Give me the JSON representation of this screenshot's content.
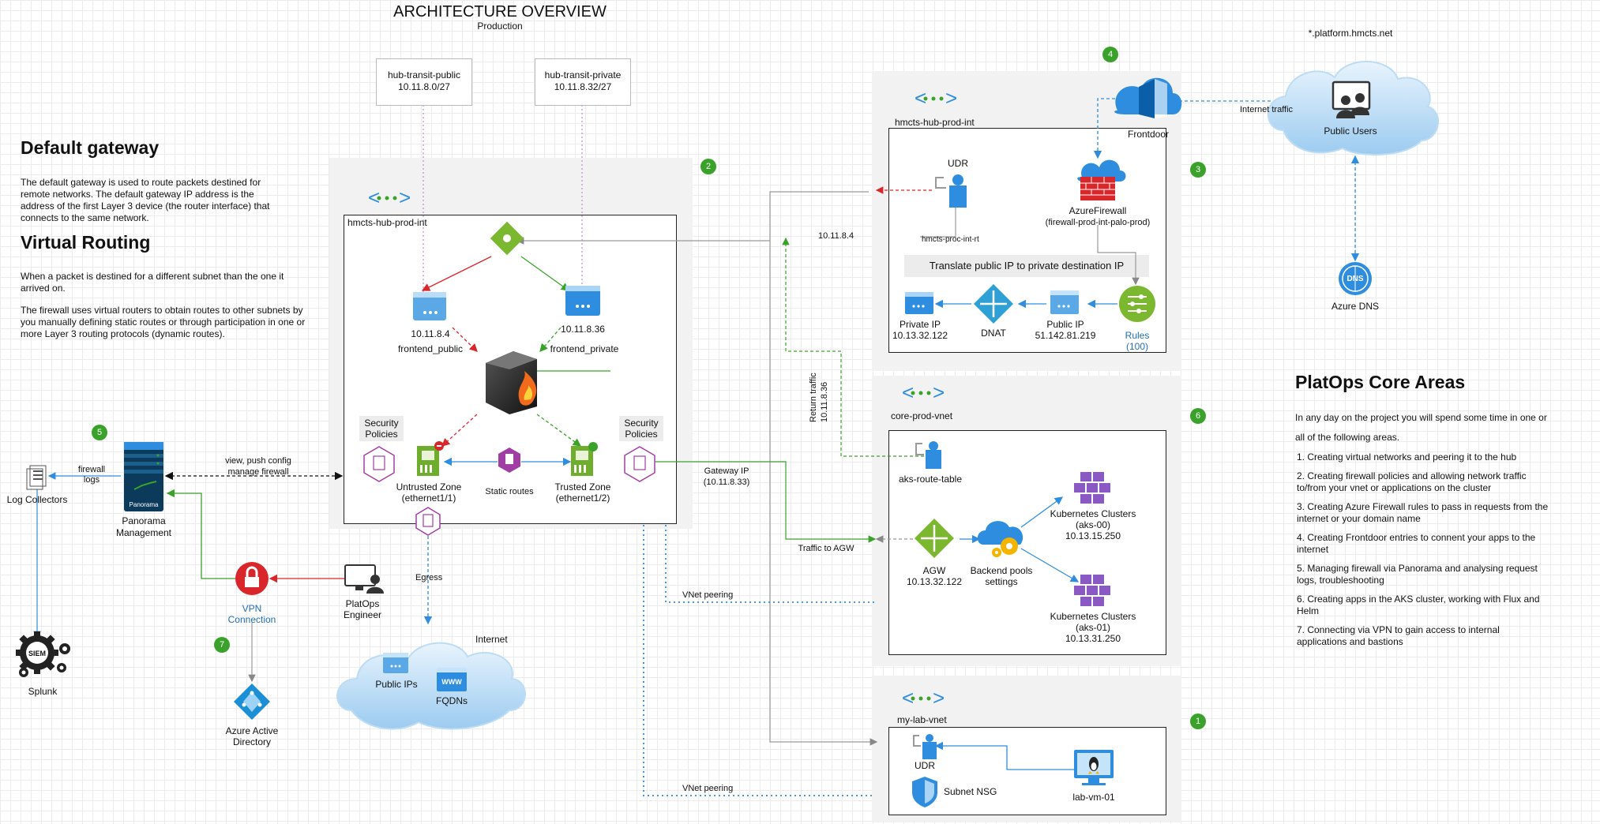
{
  "title": "ARCHITECTURE OVERVIEW",
  "subtitle": "Production",
  "default_gateway": {
    "heading": "Default gateway",
    "text": "The default gateway is used to route packets destined for remote networks. The default gateway IP address is the address of the first Layer 3 device (the router interface) that connects to the same network."
  },
  "virtual_routing": {
    "heading": "Virtual Routing",
    "p1": "When a packet is destined for a different subnet than the one it arrived on.",
    "p2": "The firewall uses virtual routers to obtain routes to other subnets by you manually defining static routes or through participation in one or more Layer 3 routing protocols (dynamic routes)."
  },
  "subnets": {
    "public": {
      "name": "hub-transit-public",
      "cidr": "10.11.8.0/27"
    },
    "private": {
      "name": "hub-transit-private",
      "cidr": "10.11.8.32/27"
    }
  },
  "hub": {
    "vnet": "hmcts-hub-prod-int",
    "frontend_public_ip": "10.11.8.4",
    "frontend_public": "frontend_public",
    "frontend_private_ip": "10.11.8.36",
    "frontend_private": "frontend_private",
    "security_policies": "Security Policies",
    "untrusted_zone": "Untrusted Zone",
    "untrusted_if": "(ethernet1/1)",
    "trusted_zone": "Trusted Zone",
    "trusted_if": "(ethernet1/2)",
    "static_routes": "Static routes"
  },
  "panorama": {
    "name": "Panorama Management",
    "badge_text": "Panorama",
    "link": "view, push config",
    "link2": "manage firewall",
    "firewall_logs": "firewall",
    "firewall_logs2": "logs"
  },
  "log_collectors": "Log Collectors",
  "splunk": "Splunk",
  "siem": "SIEM",
  "vpn": "VPN Connection",
  "engineer": "PlatOps Engineer",
  "aad": "Azure Active Directory",
  "egress": "Egress",
  "internet": {
    "label": "Internet",
    "public_ips": "Public IPs",
    "fqdns": "FQDNs",
    "www": "WWW"
  },
  "vnet_peering": "VNet peering",
  "gateway_ip": "Gateway IP",
  "gateway_ip2": "(10.11.8.33)",
  "traffic_to_agw": "Traffic to AGW",
  "return_traffic": "Return traffic",
  "return_ip": "10.11.8.36",
  "edge_ip": "10.11.8.4",
  "firewall_vnet": {
    "vnet": "hmcts-hub-prod-int",
    "udr": "UDR",
    "route_table": "hmcts-proc-int-rt",
    "azure_firewall": "AzureFirewall",
    "azure_firewall_name": "(firewall-prod-int-palo-prod)",
    "translate": "Translate public IP to private destination IP",
    "private_ip": "Private IP",
    "private_ip_val": "10.13.32.122",
    "dnat": "DNAT",
    "public_ip": "Public IP",
    "public_ip_val": "51.142.81.219",
    "rules": "Rules",
    "rules_count": "(100)"
  },
  "frontdoor": "Frontdoor",
  "internet_traffic": "Internet traffic",
  "platform_domain": "*.platform.hmcts.net",
  "public_users": "Public Users",
  "azure_dns": "Azure DNS",
  "dns": "DNS",
  "core": {
    "vnet": "core-prod-vnet",
    "aks_route_table": "aks-route-table",
    "agw": "AGW",
    "agw_ip": "10.13.32.122",
    "backend": "Backend pools",
    "backend2": "settings",
    "aks00": "Kubernetes Clusters",
    "aks00_name": "(aks-00)",
    "aks00_ip": "10.13.15.250",
    "aks01": "Kubernetes Clusters",
    "aks01_name": "(aks-01)",
    "aks01_ip": "10.13.31.250"
  },
  "lab": {
    "vnet": "my-lab-vnet",
    "udr": "UDR",
    "nsg": "Subnet NSG",
    "vm": "lab-vm-01"
  },
  "badges": [
    "1",
    "2",
    "3",
    "4",
    "5",
    "6",
    "7"
  ],
  "core_areas": {
    "heading": "PlatOps Core Areas",
    "intro1": "In any day on the project you will spend some time in one or",
    "intro2": "all of the following areas.",
    "items": [
      "1. Creating virtual networks and peering it to the hub",
      "2. Creating firewall policies and allowing network traffic to/from your vnet or applications on the cluster",
      "3. Creating Azure Firewall rules to pass in requests from the internet or your domain name",
      "4. Creating Frontdoor entries to connent your apps to the internet",
      "5. Managing firewall via Panorama and analysing request logs, troubleshooting",
      "6. Creating apps in the AKS cluster, working with Flux and Helm",
      "7. Connecting via VPN to gain access to internal applications and bastions"
    ]
  },
  "colors": {
    "green": "#3aa22b",
    "red": "#d9262b",
    "blue": "#2f8ddf",
    "azure": "#1a8fd6"
  }
}
